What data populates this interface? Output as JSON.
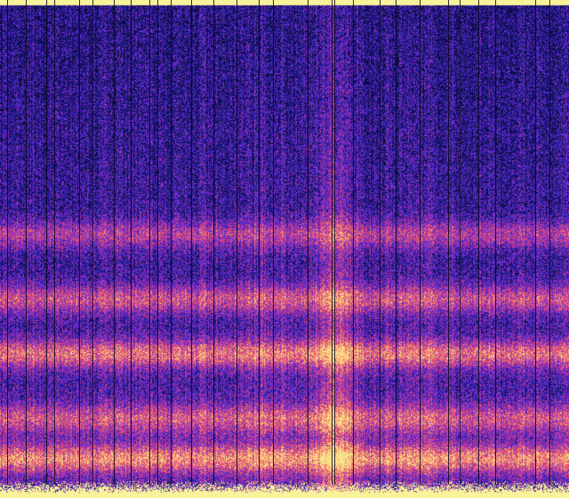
{
  "chart_data": {
    "type": "heatmap",
    "title": "",
    "xlabel": "",
    "ylabel": "",
    "colormap": [
      "#0a0a3a",
      "#1c1a8f",
      "#4a2bd0",
      "#8a2fc8",
      "#c8358f",
      "#ee5a6a",
      "#f7a36a",
      "#f8e98e"
    ],
    "background_color": "#f8f29a",
    "energy_bands": [
      {
        "center": 0.92,
        "intensity": 0.95
      },
      {
        "center": 0.84,
        "intensity": 0.7
      },
      {
        "center": 0.71,
        "intensity": 0.88
      },
      {
        "center": 0.6,
        "intensity": 0.72
      },
      {
        "center": 0.47,
        "intensity": 0.6
      }
    ],
    "bright_columns": [
      {
        "center": 0.59,
        "intensity": 0.75
      },
      {
        "center": 0.74,
        "intensity": 0.2
      },
      {
        "center": 0.47,
        "intensity": 0.25
      }
    ],
    "dropout_columns": [
      0.012,
      0.046,
      0.082,
      0.095,
      0.139,
      0.162,
      0.2,
      0.23,
      0.262,
      0.276,
      0.3,
      0.336,
      0.375,
      0.416,
      0.455,
      0.48,
      0.54,
      0.583,
      0.587,
      0.621,
      0.667,
      0.696,
      0.738,
      0.787,
      0.808,
      0.84,
      0.87,
      0.94,
      0.965
    ]
  }
}
